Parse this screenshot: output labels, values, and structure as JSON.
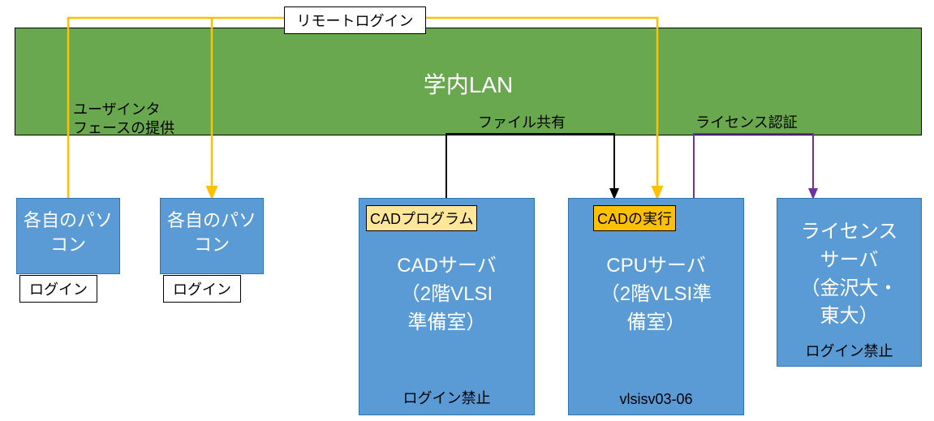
{
  "lan": {
    "title": "学内LAN"
  },
  "labels": {
    "remote_login": "リモートログイン",
    "ui_provide_l1": "ユーザインタ",
    "ui_provide_l2": "フェースの提供",
    "file_share": "ファイル共有",
    "license_auth": "ライセンス認証"
  },
  "pc1": {
    "title_l1": "各自のパソ",
    "title_l2": "コン",
    "login": "ログイン"
  },
  "pc2": {
    "title_l1": "各自のパソ",
    "title_l2": "コン",
    "login": "ログイン"
  },
  "cad": {
    "tag": "CADプログラム",
    "title_l1": "CADサーバ",
    "title_l2": "（2階VLSI",
    "title_l3": "準備室）",
    "footer": "ログイン禁止"
  },
  "cpu": {
    "tag": "CADの実行",
    "title_l1": "CPUサーバ",
    "title_l2": "（2階VLSI準",
    "title_l3": "備室）",
    "footer": "vlsisv03‐06"
  },
  "lic": {
    "title_l1": "ライセンス",
    "title_l2": "サーバ",
    "title_l3": "（金沢大・",
    "title_l4": "東大）",
    "footer": "ログイン禁止"
  }
}
